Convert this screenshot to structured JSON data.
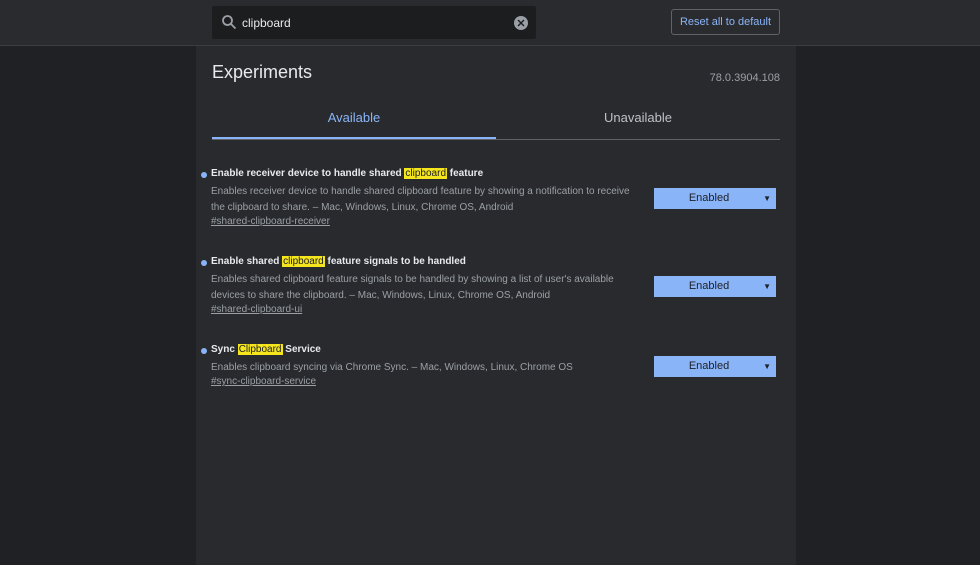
{
  "search": {
    "value": "clipboard"
  },
  "toolbar": {
    "reset_label": "Reset all to default"
  },
  "page": {
    "title": "Experiments",
    "version": "78.0.3904.108"
  },
  "tabs": [
    {
      "label": "Available"
    },
    {
      "label": "Unavailable"
    }
  ],
  "experiments": [
    {
      "title_before": "Enable receiver device to handle shared ",
      "title_highlight": "clipboard",
      "title_after": " feature",
      "description": "Enables receiver device to handle shared clipboard feature by showing a notification to receive the clipboard to share. – Mac, Windows, Linux, Chrome OS, Android",
      "link": "#shared-clipboard-receiver",
      "state": "Enabled"
    },
    {
      "title_before": "Enable shared ",
      "title_highlight": "clipboard",
      "title_after": " feature signals to be handled",
      "description": "Enables shared clipboard feature signals to be handled by showing a list of user's available devices to share the clipboard. – Mac, Windows, Linux, Chrome OS, Android",
      "link": "#shared-clipboard-ui",
      "state": "Enabled"
    },
    {
      "title_before": "Sync ",
      "title_highlight": "Clipboard",
      "title_after": " Service",
      "description": "Enables clipboard syncing via Chrome Sync. – Mac, Windows, Linux, Chrome OS",
      "link": "#sync-clipboard-service",
      "state": "Enabled"
    }
  ],
  "icons": {
    "search": "search-icon",
    "clear": "clear-icon",
    "dropdown": "chevron-down-icon"
  },
  "colors": {
    "accent": "#8ab4f8",
    "highlight": "#f4e51c",
    "background": "#202124",
    "panel": "#292a2d"
  }
}
